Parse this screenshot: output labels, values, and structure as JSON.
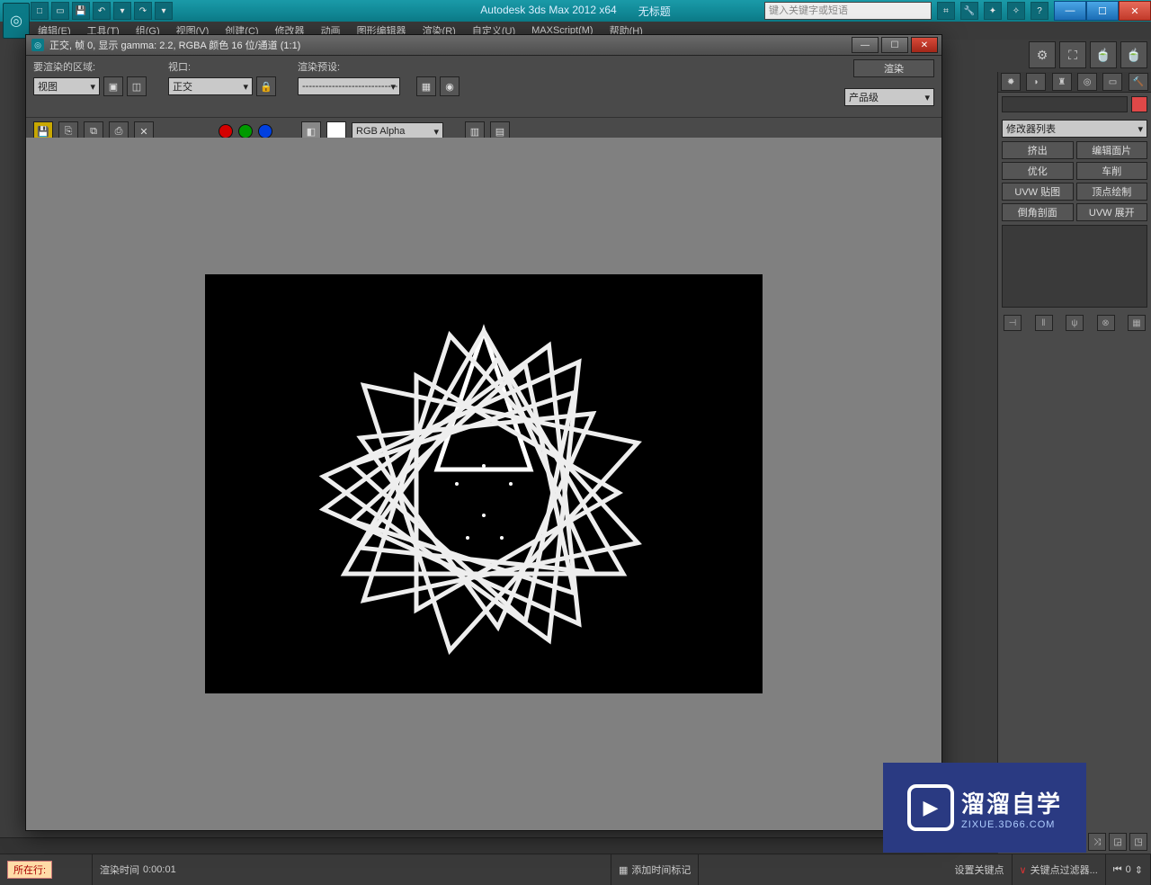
{
  "title": {
    "app": "Autodesk 3ds Max  2012 x64",
    "doc": "无标题"
  },
  "search_placeholder": "键入关键字或短语",
  "menus": [
    "编辑(E)",
    "工具(T)",
    "组(G)",
    "视图(V)",
    "创建(C)",
    "修改器",
    "动画",
    "图形编辑器",
    "渲染(R)",
    "自定义(U)",
    "MAXScript(M)",
    "帮助(H)"
  ],
  "render_window": {
    "title": "正交, 帧 0, 显示 gamma: 2.2, RGBA 颜色 16 位/通道 (1:1)",
    "area_label": "要渲染的区域:",
    "area_value": "视图",
    "viewport_label": "视口:",
    "viewport_value": "正交",
    "preset_label": "渲染预设:",
    "preset_value": "-----------------------------",
    "render_btn": "渲染",
    "prod_value": "产品级",
    "channel_value": "RGB Alpha"
  },
  "cmd_panel": {
    "mod_list": "修改器列表",
    "buttons": [
      "挤出",
      "编辑面片",
      "优化",
      "车削",
      "UVW 贴图",
      "顶点绘制",
      "倒角剖面",
      "UVW 展开"
    ]
  },
  "status": {
    "selected": "所在行:",
    "render_time_label": "渲染时间",
    "render_time": "0:00:01",
    "add_marker": "添加时间标记",
    "set_key": "设置关键点",
    "key_filter": "关键点过滤器...",
    "frame": "0"
  },
  "watermark": {
    "big": "溜溜自学",
    "small": "ZIXUE.3D66.COM"
  }
}
